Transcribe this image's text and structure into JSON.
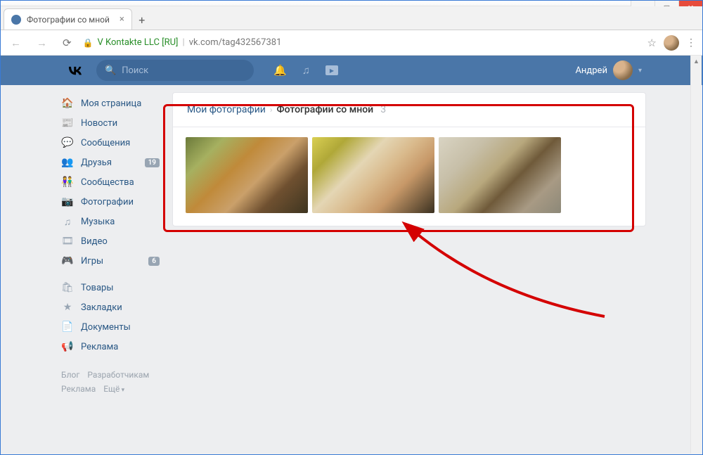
{
  "browser": {
    "tab_title": "Фотографии со мной",
    "url_company": "V Kontakte LLC [RU]",
    "url_path": "vk.com/tag432567381"
  },
  "header": {
    "search_placeholder": "Поиск",
    "username": "Андрей"
  },
  "sidebar": {
    "items": [
      {
        "icon": "home",
        "label": "Моя страница"
      },
      {
        "icon": "news",
        "label": "Новости"
      },
      {
        "icon": "msg",
        "label": "Сообщения"
      },
      {
        "icon": "friends",
        "label": "Друзья",
        "badge": "19"
      },
      {
        "icon": "groups",
        "label": "Сообщества"
      },
      {
        "icon": "photo",
        "label": "Фотографии"
      },
      {
        "icon": "music",
        "label": "Музыка"
      },
      {
        "icon": "video",
        "label": "Видео"
      },
      {
        "icon": "games",
        "label": "Игры",
        "badge": "6"
      }
    ],
    "items2": [
      {
        "icon": "market",
        "label": "Товары"
      },
      {
        "icon": "fav",
        "label": "Закладки"
      },
      {
        "icon": "docs",
        "label": "Документы"
      },
      {
        "icon": "ads",
        "label": "Реклама"
      }
    ],
    "footer": {
      "blog": "Блог",
      "devs": "Разработчикам",
      "ads": "Реклама",
      "more": "Ещё"
    }
  },
  "content": {
    "breadcrumb_root": "Мои фотографии",
    "breadcrumb_leaf": "Фотографии со мной",
    "count": "3"
  },
  "icons": {
    "home": "🏠",
    "news": "📰",
    "msg": "💬",
    "friends": "👥",
    "groups": "👫",
    "photo": "📷",
    "music": "♫",
    "video": "🎞",
    "games": "🎮",
    "market": "🛍",
    "fav": "★",
    "docs": "📄",
    "ads": "📢"
  }
}
